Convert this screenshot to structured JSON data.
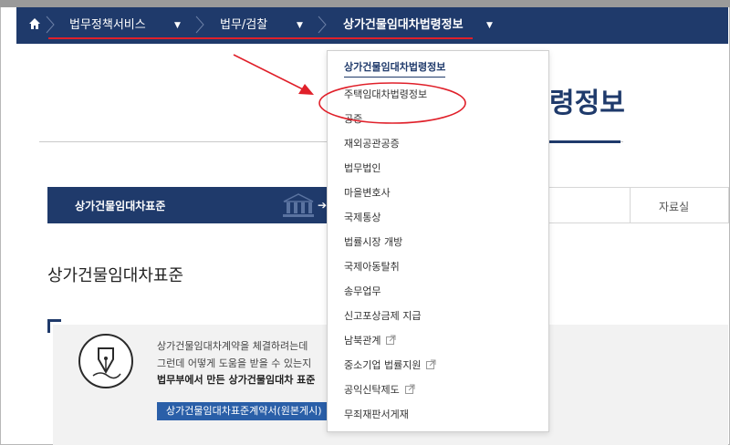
{
  "nav": {
    "home_icon": "home-icon",
    "crumbs": [
      {
        "label": "법무정책서비스"
      },
      {
        "label": "법무/검찰"
      },
      {
        "label": "상가건물임대차법령정보"
      }
    ],
    "caret": "▼"
  },
  "page": {
    "big_title": "령정보",
    "tabs": {
      "active_label": "상가건물임대차표준",
      "other_label": "자료실"
    },
    "section_title": "상가건물임대차표준",
    "info": {
      "line1": "상가건물임대차계약을 체결하려는데",
      "line2": "그런데 어떻게 도움을 받을 수 있는지",
      "line3": "법무부에서 만든 상가건물임대차 표준",
      "button_label": "상가건물임대차표준계약서(원본게시)"
    }
  },
  "dropdown": {
    "items": [
      {
        "label": "상가건물임대차법령정보",
        "selected": true,
        "external": false
      },
      {
        "label": "주택임대차법령정보",
        "selected": false,
        "external": false
      },
      {
        "label": "공증",
        "selected": false,
        "external": false
      },
      {
        "label": "재외공관공증",
        "selected": false,
        "external": false
      },
      {
        "label": "법무법인",
        "selected": false,
        "external": false
      },
      {
        "label": "마을변호사",
        "selected": false,
        "external": false
      },
      {
        "label": "국제통상",
        "selected": false,
        "external": false
      },
      {
        "label": "법률시장 개방",
        "selected": false,
        "external": false
      },
      {
        "label": "국제아동탈취",
        "selected": false,
        "external": false
      },
      {
        "label": "송무업무",
        "selected": false,
        "external": false
      },
      {
        "label": "신고포상금제 지급",
        "selected": false,
        "external": false
      },
      {
        "label": "남북관계",
        "selected": false,
        "external": true
      },
      {
        "label": "중소기업 법률지원",
        "selected": false,
        "external": true
      },
      {
        "label": "공익신탁제도",
        "selected": false,
        "external": true
      },
      {
        "label": "무죄재판서게재",
        "selected": false,
        "external": false
      }
    ]
  },
  "colors": {
    "nav_bg": "#1f3a6b",
    "annotation_red": "#e0202a",
    "button_blue": "#2a5fa8"
  }
}
